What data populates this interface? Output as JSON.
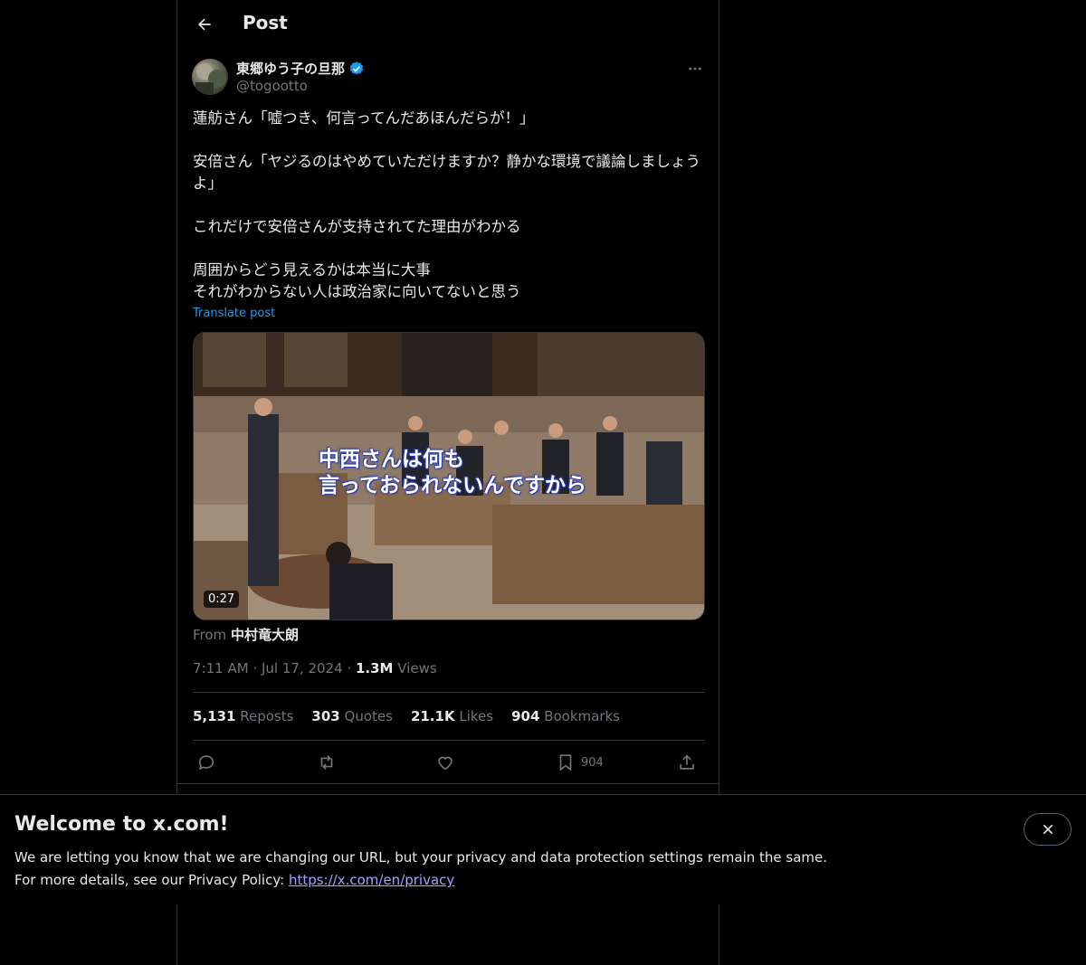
{
  "header": {
    "title": "Post"
  },
  "author": {
    "display_name": "東郷ゆう子の旦那",
    "handle": "@togootto",
    "verified_color": "#1d9bf0"
  },
  "tweet": {
    "lines": [
      "蓮舫さん「嘘つき、何言ってんだあほんだらが！」",
      "",
      "安倍さん「ヤジるのはやめていただけますか？静かな環境で議論しましょうよ」",
      "",
      "これだけで安倍さんが支持されてた理由がわかる",
      "",
      "周囲からどう見えるかは本当に大事",
      "それがわからない人は政治家に向いてないと思う"
    ],
    "translate_label": "Translate post"
  },
  "media": {
    "duration": "0:27",
    "caption": "中西さんは何も\n言っておられないんですから",
    "from_label": "From",
    "from_name": "中村竜大朗"
  },
  "meta": {
    "time": "7:11 AM",
    "date": "Jul 17, 2024",
    "views_count": "1.3M",
    "views_label": "Views"
  },
  "stats": {
    "reposts_count": "5,131",
    "reposts_label": "Reposts",
    "quotes_count": "303",
    "quotes_label": "Quotes",
    "likes_count": "21.1K",
    "likes_label": "Likes",
    "bookmarks_count": "904",
    "bookmarks_label": "Bookmarks"
  },
  "actions": {
    "reply_icon": "reply-icon",
    "repost_icon": "repost-icon",
    "like_icon": "like-icon",
    "bookmark_icon": "bookmark-icon",
    "bookmark_count": "904",
    "share_icon": "share-icon"
  },
  "banner": {
    "title": "Welcome to x.com!",
    "line1": "We are letting you know that we are changing our URL, but your privacy and data protection settings remain the same.",
    "line2_prefix": "For more details, see our Privacy Policy: ",
    "link": "https://x.com/en/privacy"
  },
  "colors": {
    "accent": "#1d9bf0",
    "text": "#e7e9ea",
    "muted": "#71767b",
    "border": "#2f3336"
  }
}
